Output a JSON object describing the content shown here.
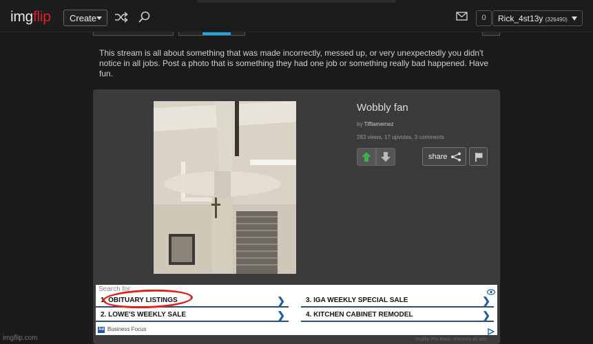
{
  "header": {
    "logo_part1": "img",
    "logo_part2": "flip",
    "create_label": "Create",
    "notifications_count": "0",
    "username": "Rick_4st13y",
    "user_points": "(326490)"
  },
  "stream_description": "This stream is all about something that was made incorrectly, messed up, or very unexpectedly you didn't notice in all jobs. Post a photo that is something they had one job or something really bad happened. Have fun.",
  "post": {
    "title": "Wobbly fan",
    "by_prefix": "by",
    "author": "Tiffiamemez",
    "stats": "283 views, 17 upvotes, 3 comments",
    "share_label": "share"
  },
  "ad": {
    "search_label": "Search for",
    "items": [
      {
        "label": "1.  OBITUARY LISTINGS"
      },
      {
        "label": "2.  LOWE'S WEEKLY SALE"
      },
      {
        "label": "3.  IGA WEEKLY SPECIAL SALE"
      },
      {
        "label": "4.  KITCHEN CABINET REMODEL"
      }
    ],
    "badge": "Ad",
    "brand": "Business Focus",
    "chevron": "❯"
  },
  "footer": {
    "site": "imgflip.com",
    "pro_note": "Imgflip Pro Basic removes all ads"
  },
  "colors": {
    "logo_red": "#d8232a",
    "active_tab": "#1ea8e0",
    "upvote_green": "#3cb043",
    "annotation_red": "#e0231a"
  }
}
